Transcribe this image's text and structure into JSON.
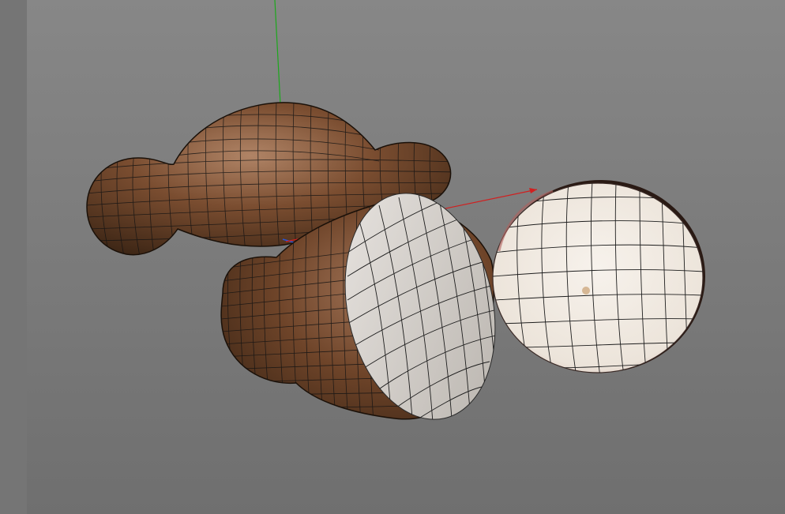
{
  "viewport": {
    "label": "3D viewport",
    "background_top": "#878787",
    "background_bottom": "#6f6f6f",
    "side_strip": "#757575"
  },
  "axes": {
    "x_color": "#d02020",
    "y_color": "#1ca81c",
    "z_color": "#2a55d8"
  },
  "objects": [
    {
      "name": "pinecone-mesh-back",
      "material": "bark-texture",
      "wireframe": true
    },
    {
      "name": "pinecone-mesh-front-cut",
      "material": "bark-texture",
      "wireframe": true
    },
    {
      "name": "cut-slice-disc",
      "material": "flesh-texture",
      "wireframe": true
    }
  ],
  "colors": {
    "bark_dark": "#3a2414",
    "bark_mid": "#7a4d30",
    "bark_light": "#b08466",
    "flesh": "#f4eee6",
    "flesh_shadow": "#d8d2ca",
    "rim": "#a55a58",
    "wire": "#141414"
  }
}
